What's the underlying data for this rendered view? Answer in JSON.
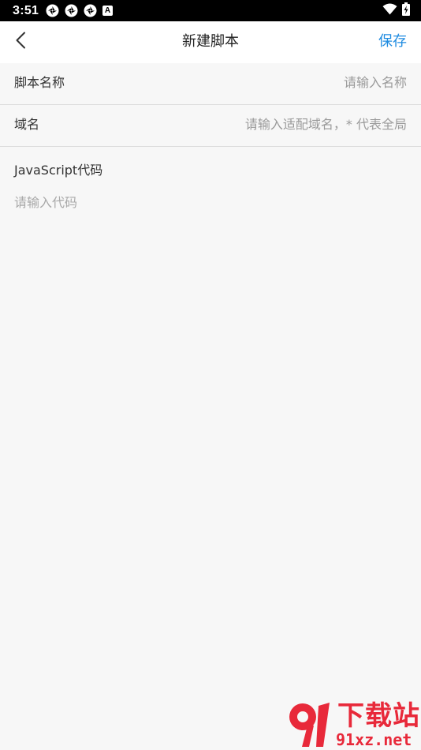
{
  "status_bar": {
    "time": "3:51",
    "notification_icons": [
      "aperture-icon",
      "aperture-icon",
      "aperture-icon",
      "a-badge-icon"
    ],
    "badge_letter": "A",
    "right_icons": [
      "wifi-icon",
      "battery-charging-icon"
    ]
  },
  "header": {
    "back_icon": "chevron-left-icon",
    "title": "新建脚本",
    "save_label": "保存"
  },
  "form": {
    "script_name": {
      "label": "脚本名称",
      "placeholder": "请输入名称",
      "value": ""
    },
    "domain": {
      "label": "域名",
      "placeholder": "请输入适配域名，* 代表全局",
      "value": ""
    },
    "code": {
      "label": "JavaScript代码",
      "placeholder": "请输入代码",
      "value": ""
    }
  },
  "watermark": {
    "main": "下载站",
    "sub": "91xz.net",
    "logo_digits": "91"
  },
  "colors": {
    "accent": "#1e8be0",
    "background": "#f7f7f7",
    "header_bg": "#ffffff",
    "status_bar_bg": "#000000",
    "divider": "#dcdcdc",
    "placeholder": "#9a9a9a",
    "watermark": "#e8293a"
  }
}
